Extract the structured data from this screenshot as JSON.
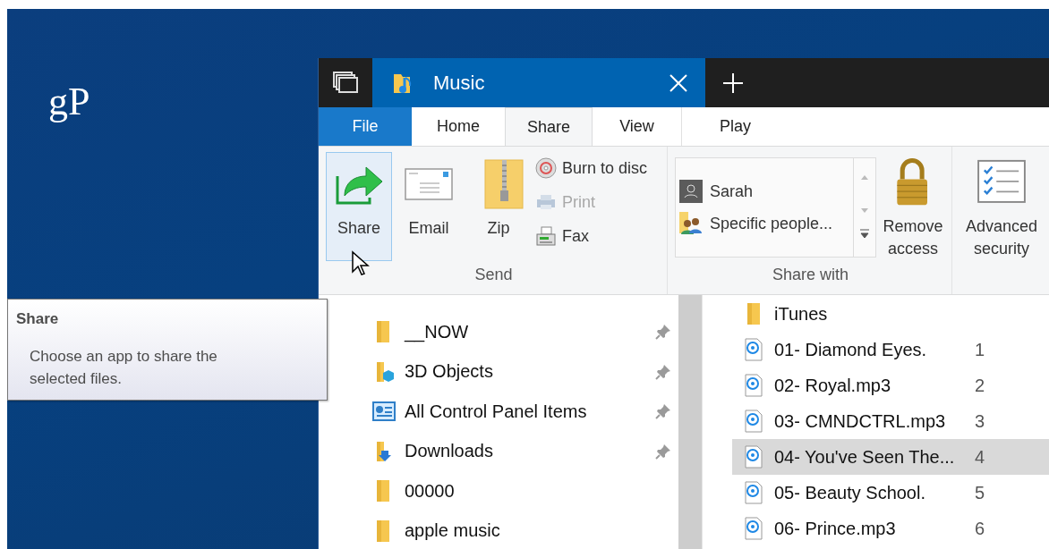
{
  "desktop": {
    "logo": "gP"
  },
  "window": {
    "tab_title": "Music"
  },
  "ribbon_tabs": [
    {
      "label": "File",
      "kind": "file",
      "selected": false
    },
    {
      "label": "Home",
      "kind": "tab",
      "selected": false
    },
    {
      "label": "Share",
      "kind": "tab",
      "selected": true
    },
    {
      "label": "View",
      "kind": "tab",
      "selected": false
    },
    {
      "label": "Play",
      "kind": "tab",
      "selected": false
    }
  ],
  "send_group": {
    "label": "Send",
    "large_buttons": [
      {
        "label": "Share",
        "kind": "share",
        "hovered": true
      },
      {
        "label": "Email",
        "kind": "email",
        "hovered": false
      },
      {
        "label": "Zip",
        "kind": "zip",
        "hovered": false
      }
    ],
    "small_buttons": [
      {
        "label": "Burn to disc",
        "kind": "disc",
        "disabled": false
      },
      {
        "label": "Print",
        "kind": "print",
        "disabled": true
      },
      {
        "label": "Fax",
        "kind": "fax",
        "disabled": false
      }
    ]
  },
  "share_with_group": {
    "label": "Share with",
    "people": [
      {
        "label": "Sarah",
        "kind": "user"
      },
      {
        "label": "Specific people...",
        "kind": "people"
      }
    ],
    "remove_access": {
      "label": "Remove access"
    }
  },
  "security_group": {
    "label": "Advanced security"
  },
  "nav_items": [
    {
      "label": "__NOW",
      "kind": "folder",
      "pinned": true
    },
    {
      "label": "3D Objects",
      "kind": "objects",
      "pinned": true
    },
    {
      "label": "All Control Panel Items",
      "kind": "control",
      "pinned": true
    },
    {
      "label": "Downloads",
      "kind": "downloads",
      "pinned": true
    },
    {
      "label": "00000",
      "kind": "folder",
      "pinned": false
    },
    {
      "label": "apple music",
      "kind": "folder",
      "pinned": false
    }
  ],
  "files": [
    {
      "name": "iTunes",
      "kind": "folder",
      "selected": false
    },
    {
      "name": "01- Diamond Eyes.",
      "kind": "audio",
      "number": "1",
      "selected": false
    },
    {
      "name": "02- Royal.mp3",
      "kind": "audio",
      "number": "2",
      "selected": false
    },
    {
      "name": "03- CMNDCTRL.mp3",
      "kind": "audio",
      "number": "3",
      "selected": false
    },
    {
      "name": "04- You've Seen The...",
      "kind": "audio",
      "number": "4",
      "selected": true
    },
    {
      "name": "05- Beauty School.",
      "kind": "audio",
      "number": "5",
      "selected": false
    },
    {
      "name": "06- Prince.mp3",
      "kind": "audio",
      "number": "6",
      "selected": false
    }
  ],
  "tooltip": {
    "title": "Share",
    "text": "Choose an app to share the selected files."
  }
}
